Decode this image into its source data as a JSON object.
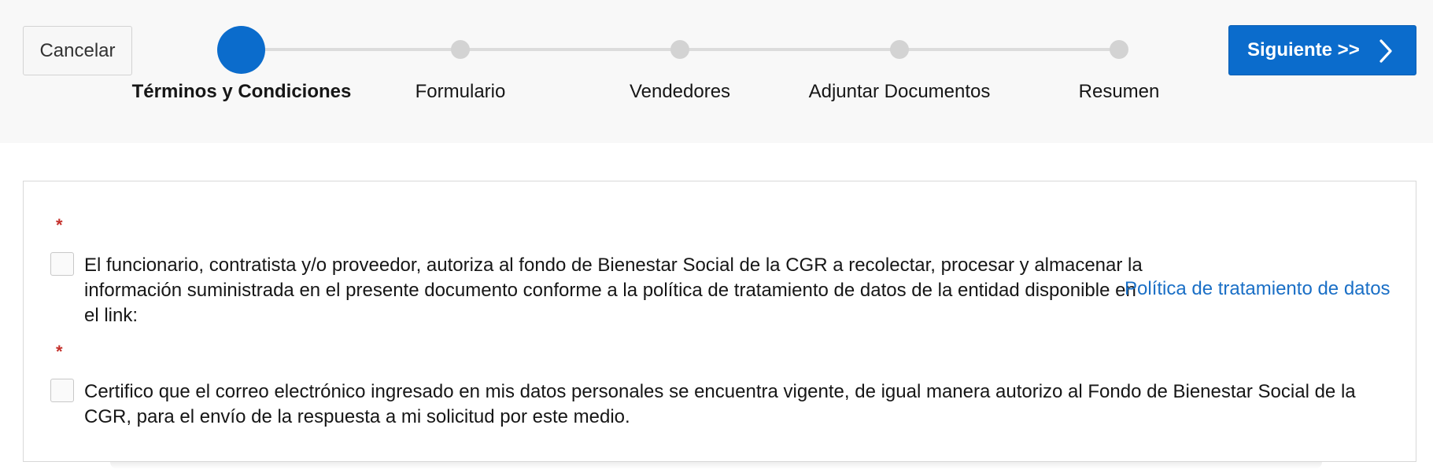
{
  "toolbar": {
    "cancel_label": "Cancelar",
    "next_label": "Siguiente >>"
  },
  "train": {
    "steps": [
      {
        "label": "Términos y Condiciones",
        "active": true
      },
      {
        "label": "Formulario",
        "active": false
      },
      {
        "label": "Vendedores",
        "active": false
      },
      {
        "label": "Adjuntar Documentos",
        "active": false
      },
      {
        "label": "Resumen",
        "active": false
      }
    ]
  },
  "terms": {
    "required_marker": "*",
    "items": [
      {
        "text": "El funcionario, contratista y/o proveedor, autoriza al fondo de Bienestar Social de la CGR a recolectar, procesar y almacenar la información suministrada en el presente documento conforme a la política de tratamiento de datos de la entidad disponible en el link:",
        "checked": false,
        "link_label": "Política de tratamiento de datos"
      },
      {
        "text": "Certifico que el correo electrónico ingresado en mis datos personales se encuentra vigente, de igual manera autorizo al Fondo de Bienestar Social de la CGR, para el envío de la respuesta a mi solicitud por este medio.",
        "checked": false
      }
    ]
  },
  "colors": {
    "accent": "#0b6ccc",
    "required": "#c4302b",
    "link": "#1a6fc6",
    "inactive_step": "#d3d3d3"
  }
}
